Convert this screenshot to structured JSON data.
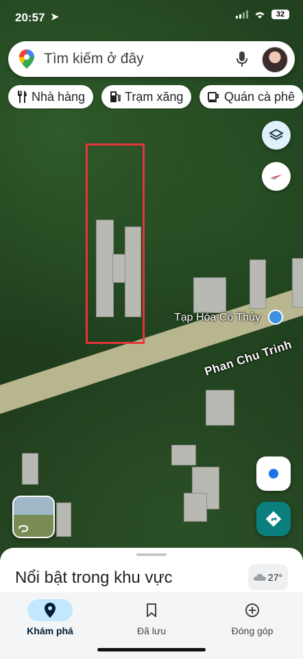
{
  "status": {
    "time": "20:57",
    "battery": "32"
  },
  "search": {
    "placeholder": "Tìm kiếm ở đây"
  },
  "chips": [
    {
      "label": "Nhà hàng",
      "icon": "fork-knife-icon"
    },
    {
      "label": "Trạm xăng",
      "icon": "gas-pump-icon"
    },
    {
      "label": "Quán cà phê",
      "icon": "coffee-cup-icon"
    }
  ],
  "map": {
    "road_label": "Phan Chu Trinh",
    "poi_label": "Tạp Hóa Cô Thủy",
    "highlight_color": "#e5343a"
  },
  "sheet": {
    "title": "Nổi bật trong khu vực",
    "temperature": "27°"
  },
  "nav": [
    {
      "label": "Khám phá",
      "icon": "explore-pin-icon",
      "active": true
    },
    {
      "label": "Đã lưu",
      "icon": "bookmark-icon",
      "active": false
    },
    {
      "label": "Đóng góp",
      "icon": "add-circle-icon",
      "active": false
    }
  ],
  "colors": {
    "accent": "#1a73e8",
    "nav_active": "#c2e7ff",
    "directions": "#0b7e7e"
  }
}
